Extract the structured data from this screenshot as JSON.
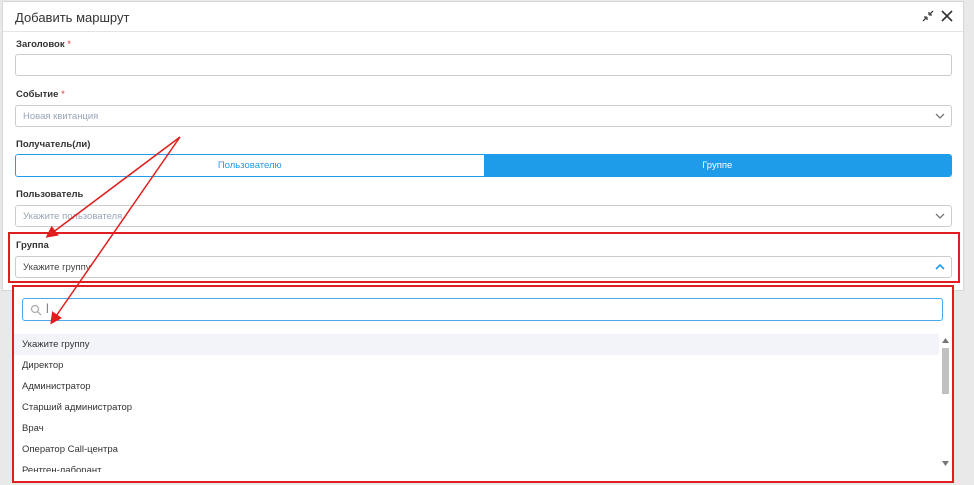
{
  "dialog": {
    "title": "Добавить маршрут"
  },
  "form": {
    "title_label": "Заголовок",
    "required_mark": "*",
    "title_value": "",
    "event_label": "Событие",
    "event_value": "Новая квитанция",
    "recipients_label": "Получатель(ли)",
    "recipient_options": [
      "Пользователю",
      "Группе"
    ],
    "recipient_selected": "Группе",
    "user_label": "Пользователь",
    "user_placeholder": "Укажите пользователя",
    "group_label": "Группа",
    "group_value": "Укажите группу"
  },
  "dropdown": {
    "search_value": "|",
    "options": [
      "Укажите группу",
      "Директор",
      "Администратор",
      "Старший администратор",
      "Врач",
      "Оператор Call-центра",
      "Рентген-лаборант"
    ],
    "highlighted_index": 0
  },
  "colors": {
    "accent": "#1e9be9",
    "annotation": "#e01e1e"
  }
}
